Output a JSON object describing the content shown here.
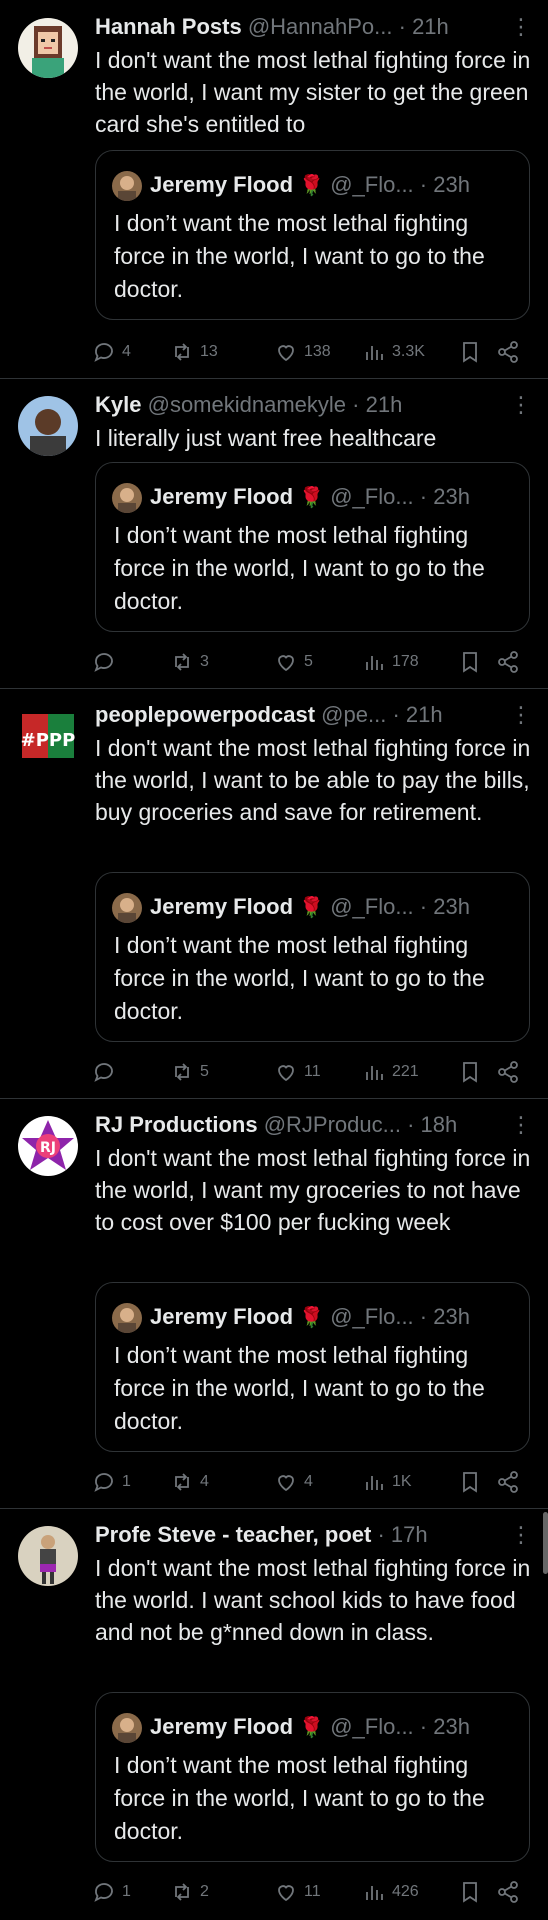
{
  "tweets": [
    {
      "name": "Hannah Posts",
      "handle": "@HannahPo...",
      "time": "21h",
      "text": "I don't want the most lethal fighting force in the world, I want my sister to get the green card she's entitled to",
      "quote": {
        "name": "Jeremy Flood",
        "handle": "@_Flo...",
        "time": "23h",
        "text": "I don’t want the most lethal fighting force in the world, I want to go to the doctor."
      },
      "replies": "4",
      "reposts": "13",
      "likes": "138",
      "views": "3.3K"
    },
    {
      "name": "Kyle",
      "handle": "@somekidnamekyle",
      "time": "21h",
      "text": "I literally just want free healthcare",
      "quote": {
        "name": "Jeremy Flood",
        "handle": "@_Flo...",
        "time": "23h",
        "text": "I don’t want the most lethal fighting force in the world, I want to go to the doctor."
      },
      "replies": "",
      "reposts": "3",
      "likes": "5",
      "views": "178"
    },
    {
      "name": "peoplepowerpodcast",
      "handle": "@pe...",
      "time": "21h",
      "text": "I don't want the most lethal fighting force in the world, I want to be able to pay the bills, buy groceries and save for retirement.",
      "quote": {
        "name": "Jeremy Flood",
        "handle": "@_Flo...",
        "time": "23h",
        "text": "I don’t want the most lethal fighting force in the world, I want to go to the doctor."
      },
      "replies": "",
      "reposts": "5",
      "likes": "11",
      "views": "221"
    },
    {
      "name": "RJ Productions",
      "handle": "@RJProduc...",
      "time": "18h",
      "text": "I don't want the most lethal fighting force in the world, I want my groceries to not have to cost over $100 per fucking week",
      "quote": {
        "name": "Jeremy Flood",
        "handle": "@_Flo...",
        "time": "23h",
        "text": "I don’t want the most lethal fighting force in the world, I want to go to the doctor."
      },
      "replies": "1",
      "reposts": "4",
      "likes": "4",
      "views": "1K"
    },
    {
      "name": "Profe Steve - teacher, poet",
      "handle": "",
      "time": "17h",
      "text": "I don't want the most lethal fighting force in the world. I want school kids to have food and not be g*nned down in class.",
      "quote": {
        "name": "Jeremy Flood",
        "handle": "@_Flo...",
        "time": "23h",
        "text": "I don’t want the most lethal fighting force in the world, I want to go to the doctor."
      },
      "replies": "1",
      "reposts": "2",
      "likes": "11",
      "views": "426"
    }
  ],
  "avatar_3_text": "#PPP",
  "avatar_4_text": "RJ",
  "dot": "·",
  "more_glyph": "⋮",
  "rose_glyph": "🌹",
  "colors": {
    "background": "#000000",
    "text": "#e7e9ea",
    "muted": "#71767b",
    "border": "#2f3336",
    "rose": "#e0245e"
  }
}
